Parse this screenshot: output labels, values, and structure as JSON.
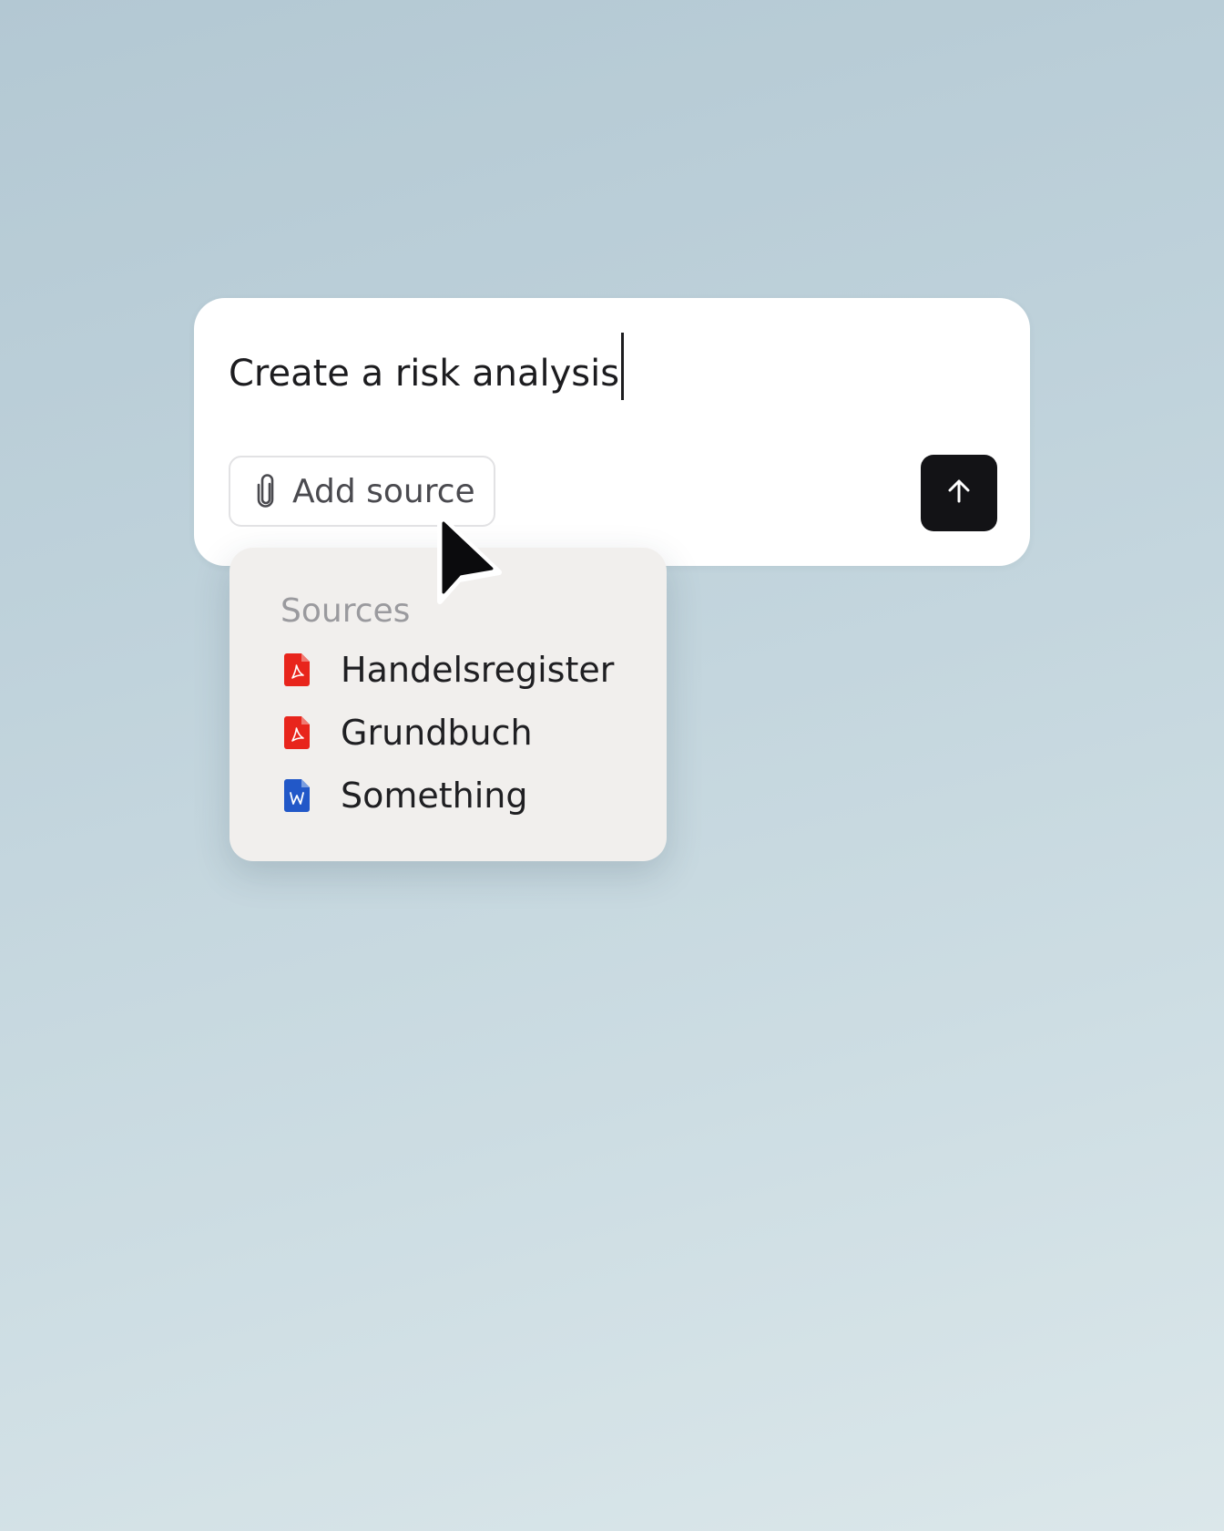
{
  "composer": {
    "prompt_text": "Create a risk analysis",
    "add_source_label": "Add source",
    "send_icon": "arrow-up-icon",
    "attach_icon": "paperclip-icon"
  },
  "sources_menu": {
    "heading": "Sources",
    "items": [
      {
        "label": "Handelsregister",
        "icon": "pdf-file-icon",
        "color": "#e8251c"
      },
      {
        "label": "Grundbuch",
        "icon": "pdf-file-icon",
        "color": "#e8251c"
      },
      {
        "label": "Something",
        "icon": "word-file-icon",
        "color": "#2258c8"
      }
    ]
  },
  "colors": {
    "send_button": "#131316",
    "pdf": "#e8251c",
    "word": "#2258c8"
  }
}
